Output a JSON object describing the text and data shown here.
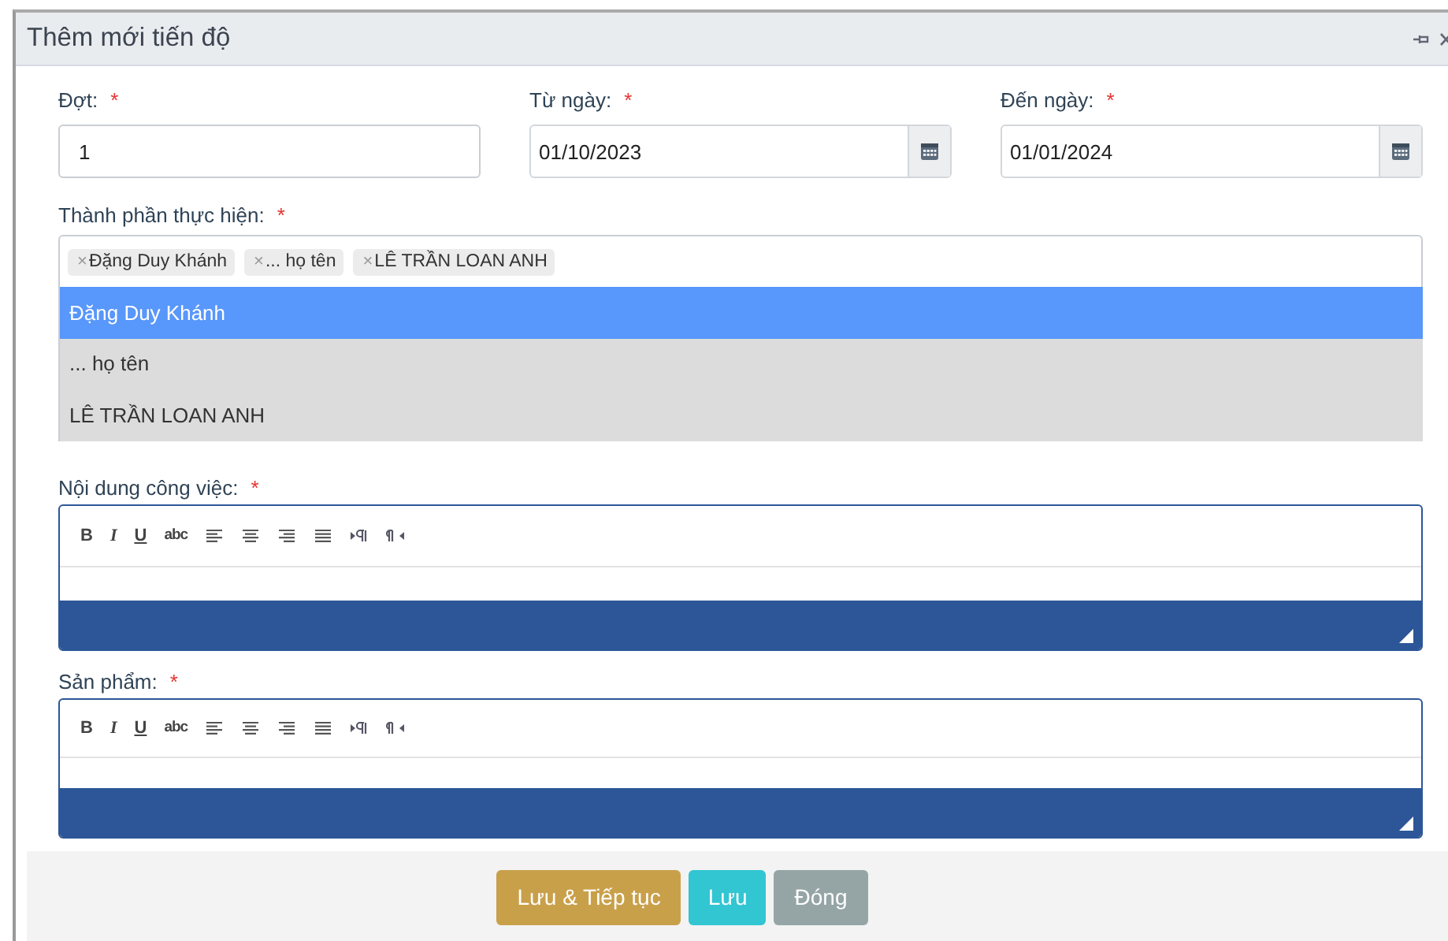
{
  "window": {
    "title": "Thêm mới tiến độ"
  },
  "fields": [
    {
      "label": "Đợt:",
      "required_mark": "*",
      "value": "1",
      "kind": "text"
    },
    {
      "label": "Từ ngày:",
      "required_mark": "*",
      "value": "01/10/2023",
      "kind": "date"
    },
    {
      "label": "Đến ngày:",
      "required_mark": "*",
      "value": "01/01/2024",
      "kind": "date"
    }
  ],
  "members": {
    "label": "Thành phần thực hiện:",
    "required_mark": "*",
    "tags": [
      {
        "remove": "×",
        "label": "Đặng Duy Khánh"
      },
      {
        "remove": "×",
        "label": "... họ tên"
      },
      {
        "remove": "×",
        "label": "LÊ TRẦN LOAN ANH"
      }
    ],
    "options": [
      {
        "label": "Đặng Duy Khánh",
        "selected": true
      },
      {
        "label": "... họ tên",
        "selected": false
      },
      {
        "label": "LÊ TRẦN LOAN ANH",
        "selected": false
      }
    ]
  },
  "editors": [
    {
      "label": "Nội dung công việc:",
      "required_mark": "*",
      "toolbar": [
        {
          "kind": "bold",
          "label": "B"
        },
        {
          "kind": "italic",
          "label": "I"
        },
        {
          "kind": "underline",
          "label": "U"
        },
        {
          "kind": "strike",
          "label": "abc"
        },
        {
          "kind": "align-left"
        },
        {
          "kind": "align-center"
        },
        {
          "kind": "align-right"
        },
        {
          "kind": "justify"
        },
        {
          "kind": "ltr"
        },
        {
          "kind": "rtl"
        }
      ]
    },
    {
      "label": "Sản phẩm:",
      "required_mark": "*",
      "toolbar": [
        {
          "kind": "bold",
          "label": "B"
        },
        {
          "kind": "italic",
          "label": "I"
        },
        {
          "kind": "underline",
          "label": "U"
        },
        {
          "kind": "strike",
          "label": "abc"
        },
        {
          "kind": "align-left"
        },
        {
          "kind": "align-center"
        },
        {
          "kind": "align-right"
        },
        {
          "kind": "justify"
        },
        {
          "kind": "ltr"
        },
        {
          "kind": "rtl"
        }
      ]
    }
  ],
  "buttons": [
    {
      "label": "Lưu & Tiếp tục",
      "kind": "continue"
    },
    {
      "label": "Lưu",
      "kind": "save"
    },
    {
      "label": "Đóng",
      "kind": "close"
    }
  ]
}
